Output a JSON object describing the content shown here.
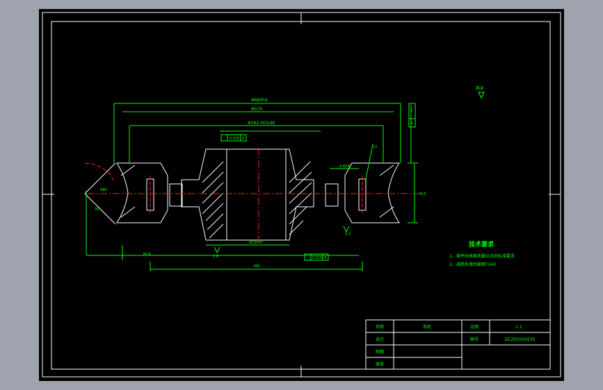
{
  "dimensions": {
    "d_overall": "Φ680h9",
    "d_flange": "Φ570",
    "d_tread": "Φ592.002/d6",
    "d_hole": "4-Φ18",
    "d_thread": "M16",
    "d_bore": "Φ100H7",
    "len_220": "220",
    "len_12": "12",
    "len_280": "280",
    "angle_r": "R80",
    "dim_small": "26",
    "dim_c": "Φ16"
  },
  "tolerances": {
    "ftol_left": "0.020",
    "ftol_bottom": "0.015",
    "ftol_sym": "A",
    "ftol_right_box": "1",
    "ftol_right_sym": "A"
  },
  "roughness": {
    "corner_mark": "其余",
    "r1": "3.2",
    "r2": "1.6"
  },
  "requirements": {
    "title": "技术要求",
    "items": [
      "1、铸件时表面质量应达到标准要求",
      "2、调质处理后硬度T240"
    ]
  },
  "title_block": {
    "name_label": "名称",
    "name_value": "车轮",
    "scale_label": "比例",
    "scale_value": "1:1",
    "design_label": "设计",
    "drawing_no_label": "图号",
    "drawing_no_value": "DCZ01000235",
    "drawn_label": "制图",
    "check_label": "审核"
  }
}
